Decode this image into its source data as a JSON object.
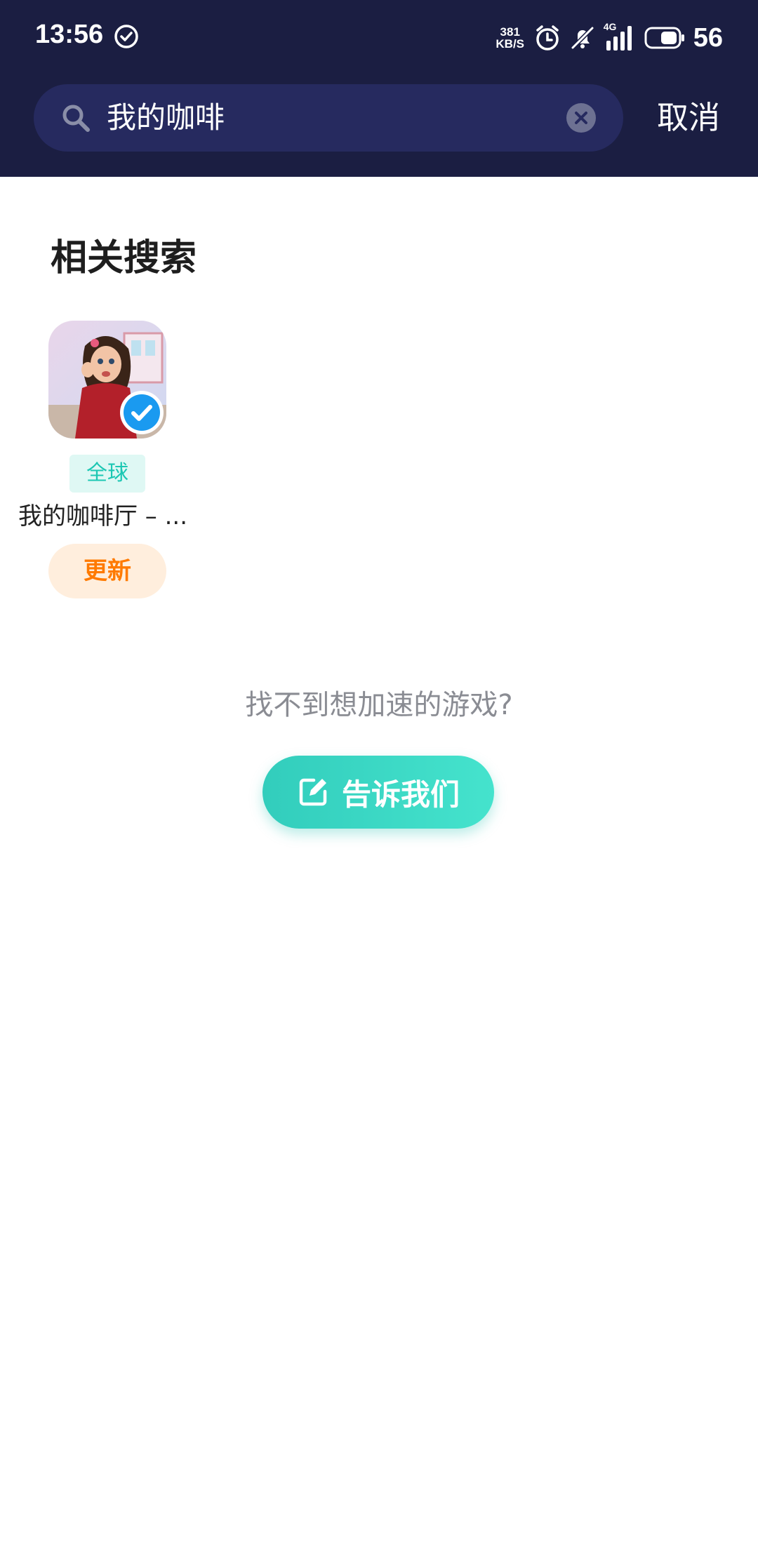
{
  "status_bar": {
    "time": "13:56",
    "net_speed_value": "381",
    "net_speed_unit": "KB/S",
    "network_type": "4G",
    "battery_level": "56",
    "icons": [
      "check-circle-icon",
      "alarm-icon",
      "mute-bell-icon",
      "signal-icon",
      "battery-icon"
    ]
  },
  "search": {
    "query": "我的咖啡",
    "cancel_label": "取消"
  },
  "related": {
    "title": "相关搜索",
    "items": [
      {
        "region_tag": "全球",
        "name": "我的咖啡厅 – ...",
        "action_label": "更新"
      }
    ]
  },
  "feedback": {
    "prompt": "找不到想加速的游戏?",
    "button_label": "告诉我们"
  },
  "colors": {
    "header_bg": "#1b1e42",
    "search_bg": "#262a5f",
    "accent_teal": "#3fd9c6",
    "update_orange": "#ff7a00",
    "verified_blue": "#1a9af0"
  }
}
